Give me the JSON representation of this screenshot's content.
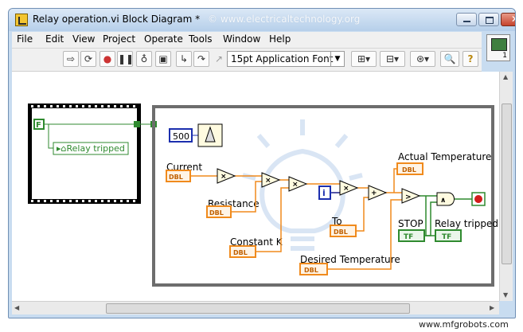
{
  "window": {
    "title": "Relay operation.vi Block Diagram *",
    "watermark": "© www.electricaltechnology.org"
  },
  "menu": [
    "File",
    "Edit",
    "View",
    "Project",
    "Operate",
    "Tools",
    "Window",
    "Help"
  ],
  "toolbar": {
    "font_label": "15pt Application Font"
  },
  "context_help": {
    "number": "1"
  },
  "diagram": {
    "outer_loop": {
      "bool_const": "F",
      "indicator_label": "Relay tripped"
    },
    "numeric_const": "500",
    "labels": {
      "current": "Current",
      "resistance": "Resistance",
      "constant_k": "Constant K",
      "to": "To",
      "desired_temperature": "Desired Temperature",
      "actual_temperature": "Actual Temperature",
      "stop": "STOP",
      "relay_tripped": "Relay tripped"
    },
    "terminals": {
      "dbl": "DBL",
      "tf": "TF",
      "iteration": "i"
    },
    "colors": {
      "wire_orange": "#f08a1c",
      "wire_green": "#2f8a2f",
      "terminal_blue": "#1c2fae"
    }
  },
  "footer": {
    "watermark": "www.mfgrobots.com"
  }
}
